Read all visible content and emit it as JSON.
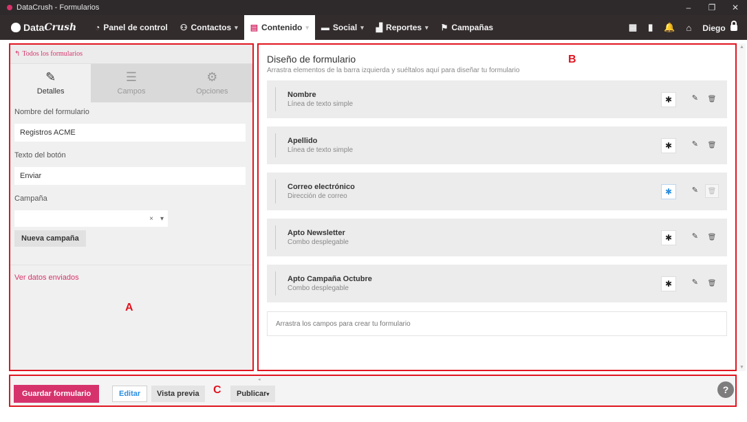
{
  "window": {
    "title": "DataCrush - Formularios",
    "controls": [
      "–",
      "❐",
      "✕"
    ]
  },
  "navbar": {
    "brand_a": "Data",
    "brand_b": "Crush",
    "items": [
      {
        "label": "Panel de control",
        "icon": "◔",
        "caret": ""
      },
      {
        "label": "Contactos",
        "icon": "⚇",
        "caret": "▾"
      },
      {
        "label": "Contenido",
        "icon": "▤",
        "caret": "▾"
      },
      {
        "label": "Social",
        "icon": "▬",
        "caret": "▾"
      },
      {
        "label": "Reportes",
        "icon": "▟",
        "caret": "▾"
      },
      {
        "label": "Campañas",
        "icon": "⚑",
        "caret": ""
      }
    ],
    "right_icons": [
      "▦",
      "▮",
      "🔔",
      "⌂"
    ],
    "user": "Diego"
  },
  "left_panel": {
    "back_link": "Todos los formularios",
    "tabs": [
      {
        "label": "Detalles",
        "icon": "✎"
      },
      {
        "label": "Campos",
        "icon": "☰"
      },
      {
        "label": "Opciones",
        "icon": "⚙"
      }
    ],
    "form_name_label": "Nombre del formulario",
    "form_name_value": "Registros ACME",
    "button_text_label": "Texto del botón",
    "button_text_value": "Enviar",
    "campaign_label": "Campaña",
    "campaign_clear": "×",
    "campaign_caret": "▾",
    "new_campaign": "Nueva campaña",
    "view_submitted": "Ver datos enviados"
  },
  "right_panel": {
    "title": "Diseño de formulario",
    "subtitle": "Arrastra elementos de la barra izquierda y suéltalos aquí para diseñar tu formulario",
    "fields": [
      {
        "name": "Nombre",
        "type": "Línea de texto simple",
        "required_active": false
      },
      {
        "name": "Apellido",
        "type": "Línea de texto simple",
        "required_active": false
      },
      {
        "name": "Correo electrónico",
        "type": "Dirección de correo",
        "required_active": true
      },
      {
        "name": "Apto Newsletter",
        "type": "Combo desplegable",
        "required_active": false
      },
      {
        "name": "Apto Campaña Octubre",
        "type": "Combo desplegable",
        "required_active": false
      }
    ],
    "drop_hint": "Arrastra los campos para crear tu formulario"
  },
  "bottom_bar": {
    "save": "Guardar formulario",
    "edit": "Editar",
    "preview": "Vista previa",
    "publish": "Publicar",
    "publish_caret": "▾",
    "help": "?"
  },
  "annotations": {
    "a": "A",
    "b": "B",
    "c": "C"
  },
  "colors": {
    "accent": "#d6336c",
    "annotation": "#e0141f",
    "navbar": "#332c2d",
    "link_blue": "#2b8de0"
  }
}
